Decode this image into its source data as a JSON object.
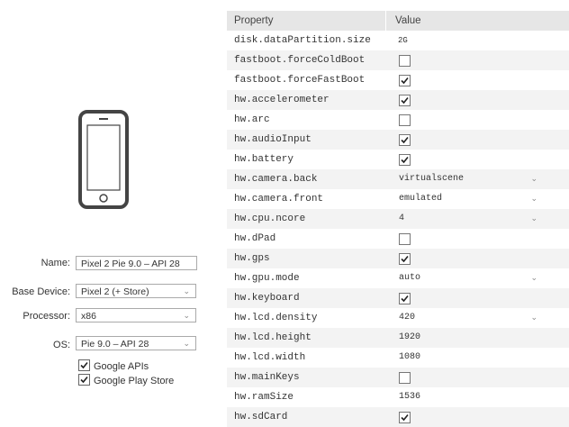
{
  "device": {
    "name_label": "Name:",
    "name_value": "Pixel 2 Pie 9.0 – API 28",
    "base_device_label": "Base Device:",
    "base_device_value": "Pixel 2 (+ Store)",
    "processor_label": "Processor:",
    "processor_value": "x86",
    "os_label": "OS:",
    "os_value": "Pie 9.0 – API 28",
    "google_apis_label": "Google APIs",
    "google_apis_checked": true,
    "google_play_label": "Google Play Store",
    "google_play_checked": true,
    "phone_icon": "phone-icon"
  },
  "table": {
    "headers": {
      "property": "Property",
      "value": "Value"
    },
    "rows": [
      {
        "property": "disk.dataPartition.size",
        "type": "text",
        "value": "2G"
      },
      {
        "property": "fastboot.forceColdBoot",
        "type": "checkbox",
        "checked": false
      },
      {
        "property": "fastboot.forceFastBoot",
        "type": "checkbox",
        "checked": true
      },
      {
        "property": "hw.accelerometer",
        "type": "checkbox",
        "checked": true
      },
      {
        "property": "hw.arc",
        "type": "checkbox",
        "checked": false
      },
      {
        "property": "hw.audioInput",
        "type": "checkbox",
        "checked": true
      },
      {
        "property": "hw.battery",
        "type": "checkbox",
        "checked": true
      },
      {
        "property": "hw.camera.back",
        "type": "dropdown",
        "value": "virtualscene"
      },
      {
        "property": "hw.camera.front",
        "type": "dropdown",
        "value": "emulated"
      },
      {
        "property": "hw.cpu.ncore",
        "type": "dropdown",
        "value": "4"
      },
      {
        "property": "hw.dPad",
        "type": "checkbox",
        "checked": false
      },
      {
        "property": "hw.gps",
        "type": "checkbox",
        "checked": true
      },
      {
        "property": "hw.gpu.mode",
        "type": "dropdown",
        "value": "auto"
      },
      {
        "property": "hw.keyboard",
        "type": "checkbox",
        "checked": true
      },
      {
        "property": "hw.lcd.density",
        "type": "dropdown",
        "value": "420"
      },
      {
        "property": "hw.lcd.height",
        "type": "value",
        "value": "1920"
      },
      {
        "property": "hw.lcd.width",
        "type": "value",
        "value": "1080"
      },
      {
        "property": "hw.mainKeys",
        "type": "checkbox",
        "checked": false
      },
      {
        "property": "hw.ramSize",
        "type": "value",
        "value": "1536"
      },
      {
        "property": "hw.sdCard",
        "type": "checkbox",
        "checked": true
      }
    ]
  }
}
